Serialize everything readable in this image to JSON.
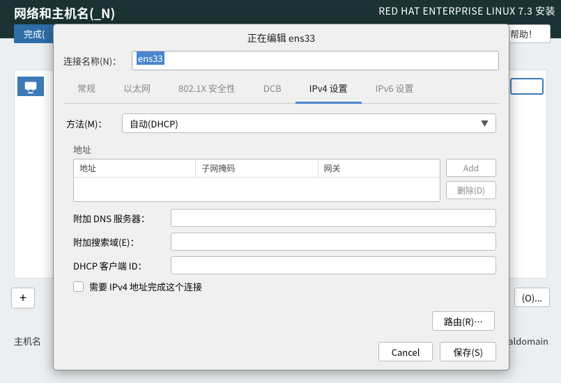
{
  "header": {
    "title": "网络和主机名(_N)",
    "subtitle": "RED HAT ENTERPRISE LINUX 7.3 安装",
    "done": "完成(",
    "help": "帮助！"
  },
  "bg": {
    "configure": "(O)...",
    "plus": "+",
    "host_label": "主机名",
    "domain_tail": "ocaldomain"
  },
  "dialog": {
    "title": "正在编辑 ens33",
    "conn_label": "连接名称(N)：",
    "conn_value": "ens33",
    "tabs": [
      "常规",
      "以太网",
      "802.1X 安全性",
      "DCB",
      "IPv4 设置",
      "IPv6 设置"
    ],
    "active_tab": 4,
    "method_label": "方法(M)：",
    "method_value": "自动(DHCP)",
    "addr_section": "地址",
    "addr_cols": [
      "地址",
      "子网掩码",
      "网关"
    ],
    "add_btn": "Add",
    "del_btn": "删除(D)",
    "dns_label": "附加 DNS 服务器：",
    "search_label": "附加搜索域(E)：",
    "dhcp_label": "DHCP 客户端 ID：",
    "require_chk": "需要 IPv4 地址完成这个连接",
    "route_btn": "路由(R)…",
    "cancel": "Cancel",
    "save": "保存(S)"
  }
}
